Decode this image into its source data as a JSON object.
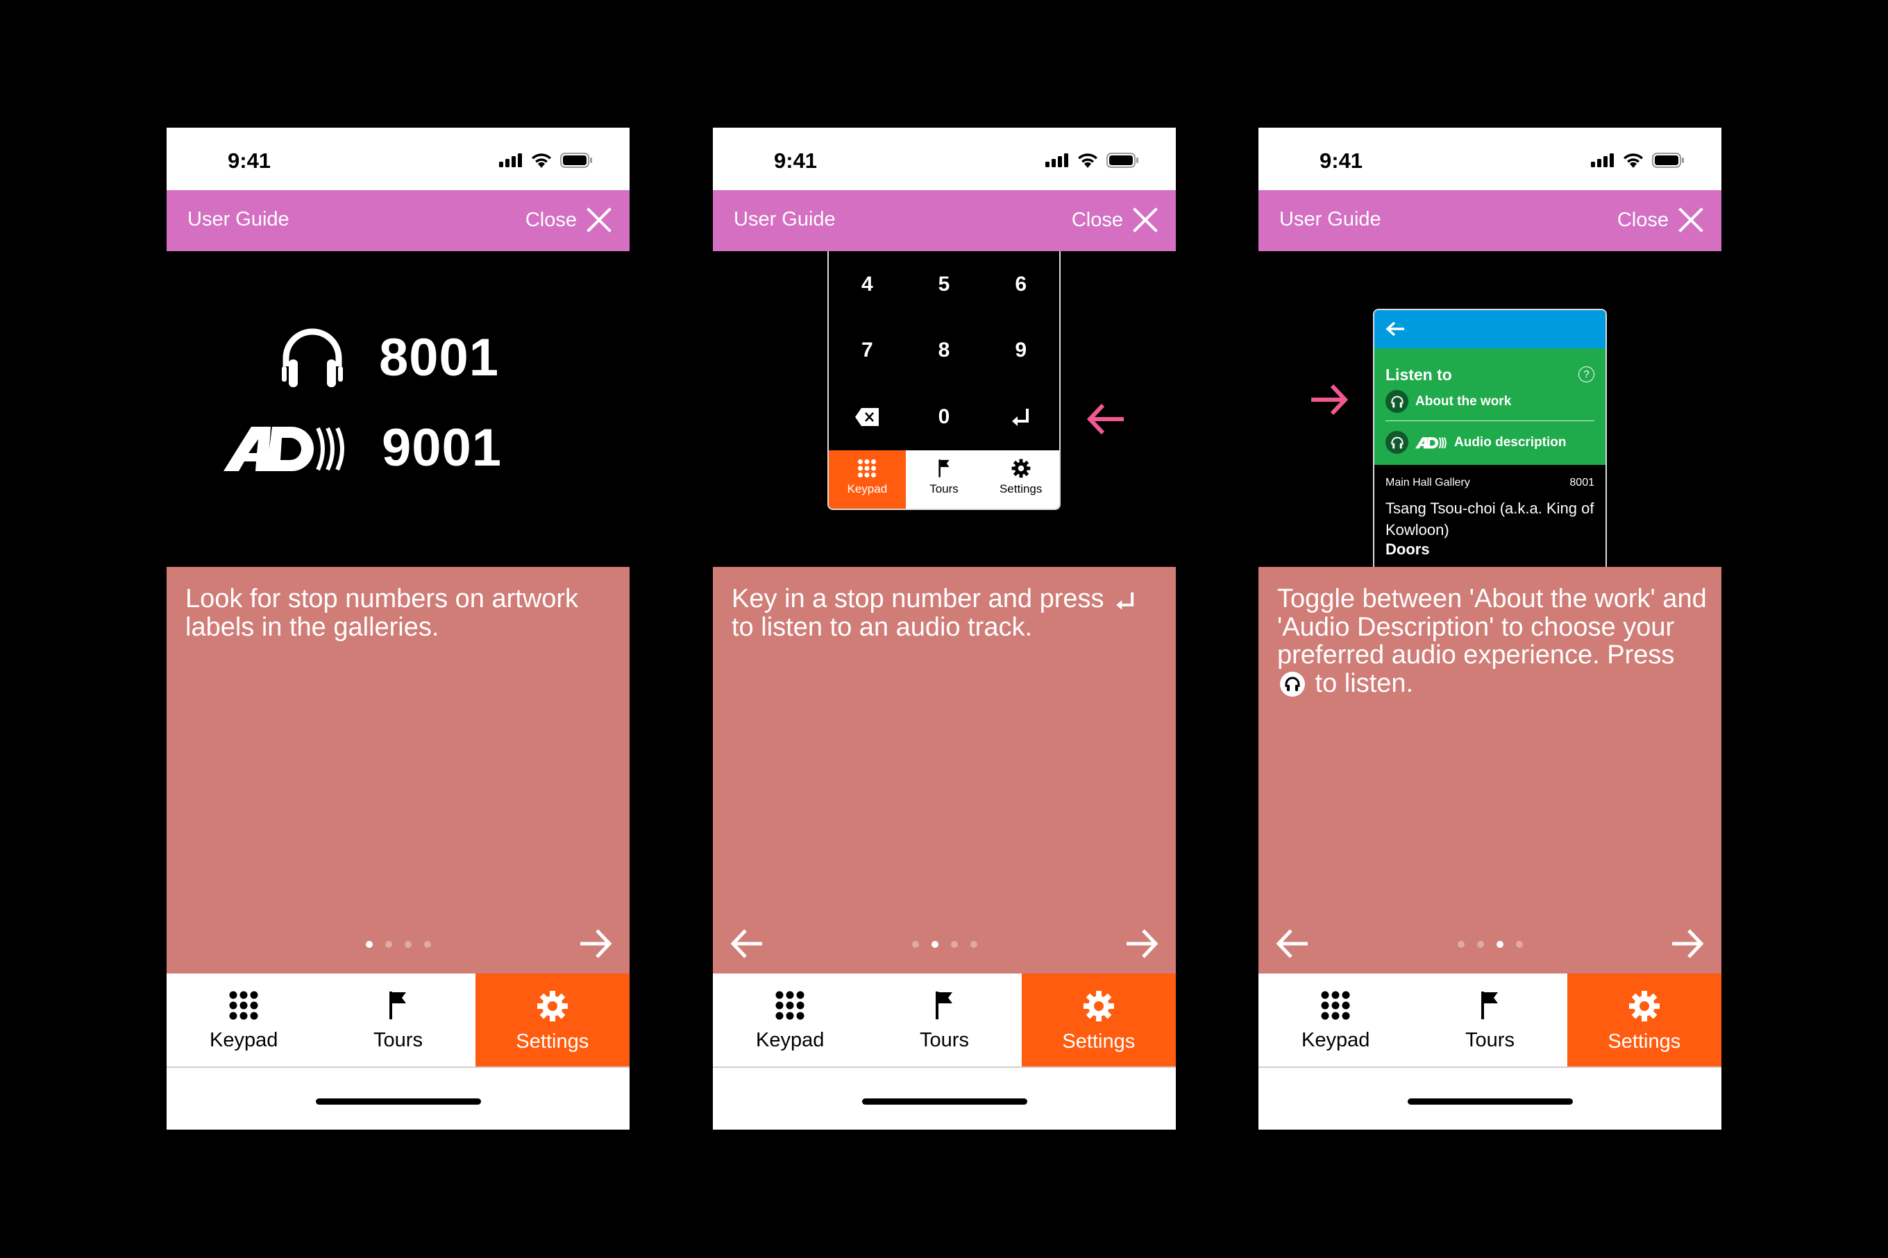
{
  "colors": {
    "header": "#d46fc2",
    "body": "#d07c77",
    "active_tab": "#ff5c0f",
    "accent_arrow": "#f0588f",
    "card_blue": "#009bdf",
    "card_green": "#1faa4b"
  },
  "status_bar": {
    "time": "9:41",
    "icons": [
      "signal-icon",
      "wifi-icon",
      "battery-icon"
    ]
  },
  "header": {
    "title": "User Guide",
    "close_label": "Close",
    "close_icon": "close-icon"
  },
  "tabs": [
    {
      "label": "Keypad",
      "icon": "keypad-icon"
    },
    {
      "label": "Tours",
      "icon": "flag-icon"
    },
    {
      "label": "Settings",
      "icon": "gear-icon",
      "active": true
    }
  ],
  "screens": [
    {
      "step": 1,
      "total_steps": 4,
      "stop_codes": [
        {
          "icon": "headphones-icon",
          "number": "8001"
        },
        {
          "icon": "audio-description-icon",
          "number": "9001"
        }
      ],
      "description": "Look for stop numbers on artwork labels in the galleries.",
      "has_prev": false,
      "has_next": true
    },
    {
      "step": 2,
      "total_steps": 4,
      "keypad": {
        "keys": [
          "4",
          "5",
          "6",
          "7",
          "8",
          "9",
          "backspace",
          "0",
          "enter"
        ],
        "tabs": [
          {
            "label": "Keypad",
            "active": true
          },
          {
            "label": "Tours"
          },
          {
            "label": "Settings"
          }
        ]
      },
      "description_parts": [
        "Key in a stop number and press ",
        "enter-icon",
        " to listen to an audio track."
      ],
      "has_prev": true,
      "has_next": true
    },
    {
      "step": 3,
      "total_steps": 4,
      "listen_card": {
        "title": "Listen to",
        "options": [
          "About the work",
          "Audio description"
        ],
        "gallery": "Main Hall Gallery",
        "stop_number": "8001",
        "artist": "Tsang Tsou-choi (a.k.a. King of Kowloon)",
        "work_title": "Doors"
      },
      "description_parts": [
        "Toggle between 'About the work' and 'Audio Description' to choose your preferred audio experience. Press ",
        "headphones-icon",
        " to listen."
      ],
      "has_prev": true,
      "has_next": true
    }
  ]
}
